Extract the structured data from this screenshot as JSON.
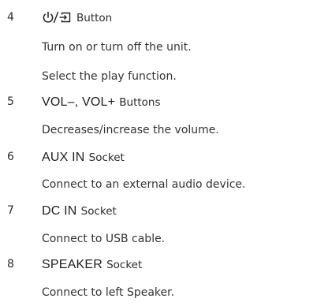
{
  "items": [
    {
      "number": "4",
      "icon": "power-input-icon",
      "key": "",
      "key_glyph": "⏻/⇥",
      "word": "Button",
      "descriptions": [
        "Turn on or turn off the unit.",
        "Select the play function."
      ]
    },
    {
      "number": "5",
      "key": "VOL–, VOL+",
      "word": "Buttons",
      "descriptions": [
        "Decreases/increase the volume."
      ]
    },
    {
      "number": "6",
      "key": "AUX IN",
      "word": "Socket",
      "descriptions": [
        "Connect to an external audio device."
      ]
    },
    {
      "number": "7",
      "key": "DC IN",
      "word": "Socket",
      "descriptions": [
        "Connect to USB cable."
      ]
    },
    {
      "number": "8",
      "key": "SPEAKER",
      "word": "Socket",
      "descriptions": [
        "Connect to left Speaker."
      ]
    }
  ]
}
